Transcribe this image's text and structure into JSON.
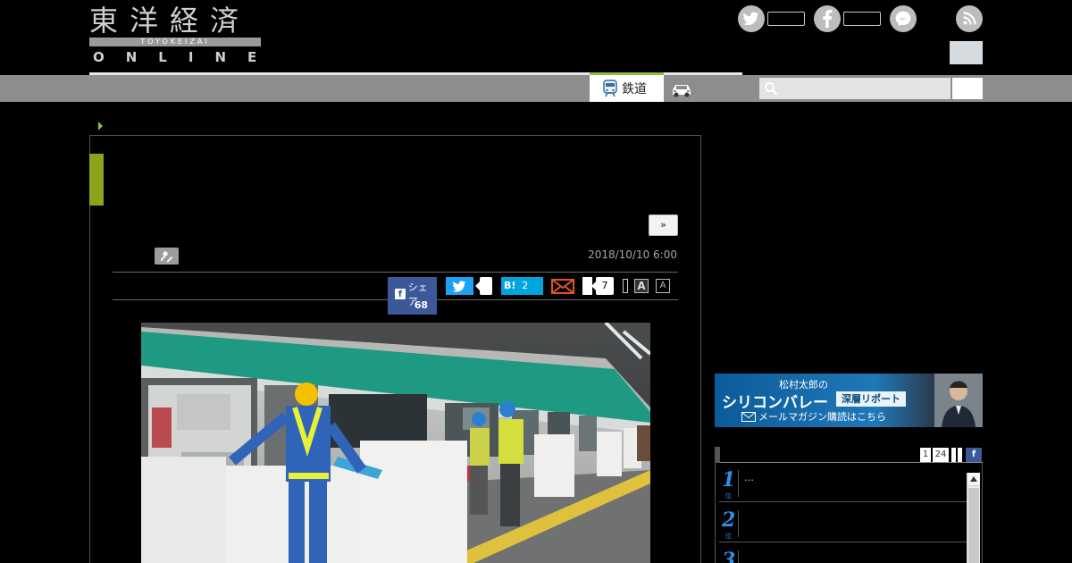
{
  "header": {
    "logo_kanji": "東洋経済",
    "logo_roman": "TOYOKEIZAI",
    "logo_online": "ONLINE"
  },
  "nav": {
    "tabs": [
      {
        "label": "鉄道",
        "icon": "train-icon",
        "active": true
      },
      {
        "label": "",
        "icon": "car-icon",
        "active": false
      }
    ],
    "search": {
      "placeholder": "",
      "value": ""
    }
  },
  "article": {
    "next_label": "»",
    "date": "2018/10/10 6:00",
    "share": {
      "facebook_label": "シェア",
      "facebook_count": "68",
      "hatena_label": "B!",
      "hatena_count": "2",
      "comment_count": "7",
      "font_large": "A",
      "font_small": "A"
    }
  },
  "sidebar": {
    "banner": {
      "sub": "松村太郎の",
      "title": "シリコンバレー",
      "tag": "深層リポート",
      "mail": "メールマガジン購読はこちら"
    },
    "ranking": {
      "pages": [
        "1",
        "24"
      ],
      "fb": "f",
      "items": [
        {
          "rank": "1",
          "unit": "位",
          "text": "…"
        },
        {
          "rank": "2",
          "unit": "位",
          "text": ""
        },
        {
          "rank": "3",
          "unit": "位",
          "text": ""
        }
      ]
    }
  },
  "colors": {
    "accent_green": "#8aa51c",
    "facebook": "#3b5998",
    "twitter": "#1da1f2",
    "hatena": "#00a4de",
    "rank_blue": "#2f8fe6"
  }
}
